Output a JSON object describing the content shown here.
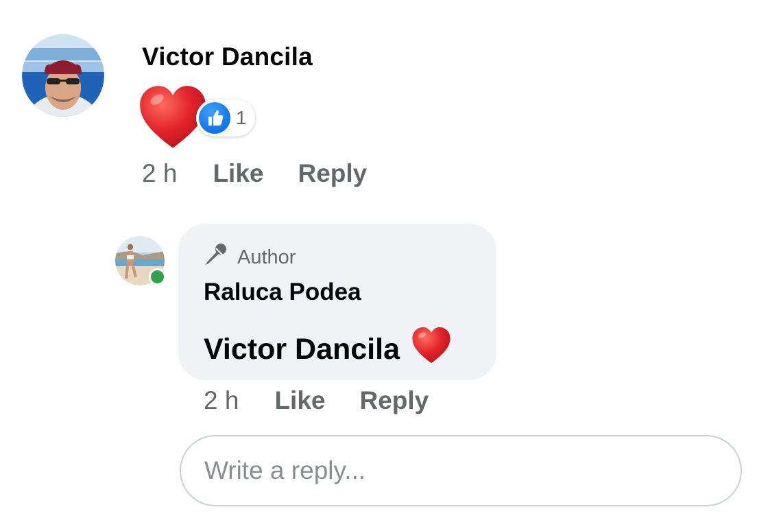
{
  "comment": {
    "author_name": "Victor Dancila",
    "content_emoji": "heart",
    "reactions": {
      "type": "like",
      "count": "1"
    },
    "time": "2 h",
    "like_label": "Like",
    "reply_label": "Reply"
  },
  "reply": {
    "badge_label": "Author",
    "author_name": "Raluca Podea",
    "mention": "Victor Dancila",
    "content_emoji": "heart",
    "online": true,
    "time": "2 h",
    "like_label": "Like",
    "reply_label": "Reply"
  },
  "reply_input": {
    "placeholder": "Write a reply..."
  },
  "colors": {
    "secondary_text": "#65676b",
    "bubble_bg": "#f0f2f5",
    "like_blue": "#1877f2",
    "heart_red": "#e3242b",
    "online_green": "#31a24c"
  },
  "icons": {
    "author_badge": "microphone-icon",
    "reaction": "thumbs-up-icon",
    "emoji": "red-heart-icon"
  }
}
